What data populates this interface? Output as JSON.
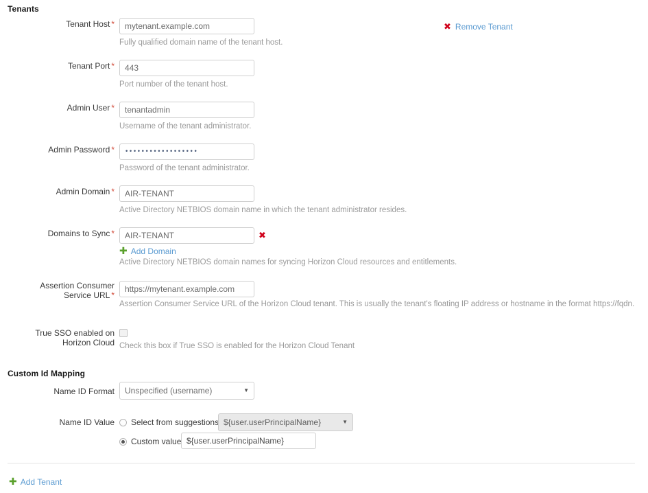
{
  "sections": {
    "tenants_heading": "Tenants",
    "custom_id_heading": "Custom Id Mapping"
  },
  "actions": {
    "remove_tenant": "Remove Tenant",
    "add_domain": "Add Domain",
    "add_tenant": "Add Tenant",
    "remove_domain_icon": "✖",
    "remove_tenant_icon": "✖",
    "add_icon": "✚"
  },
  "fields": {
    "tenant_host": {
      "label": "Tenant Host",
      "required": "*",
      "value": "mytenant.example.com",
      "hint": "Fully qualified domain name of the tenant host."
    },
    "tenant_port": {
      "label": "Tenant Port",
      "required": "*",
      "value": "443",
      "hint": "Port number of the tenant host."
    },
    "admin_user": {
      "label": "Admin User",
      "required": "*",
      "value": "tenantadmin",
      "hint": "Username of the tenant administrator."
    },
    "admin_password": {
      "label": "Admin Password",
      "required": "*",
      "value": "••••••••••••••••••",
      "hint": "Password of the tenant administrator."
    },
    "admin_domain": {
      "label": "Admin Domain",
      "required": "*",
      "value": "AIR-TENANT",
      "hint": "Active Directory NETBIOS domain name in which the tenant administrator resides."
    },
    "domains_to_sync": {
      "label": "Domains to Sync",
      "required": "*",
      "value": "AIR-TENANT",
      "hint": "Active Directory NETBIOS domain names for syncing Horizon Cloud resources and entitlements."
    },
    "assertion_url": {
      "label_line1": "Assertion Consumer",
      "label_line2": "Service URL",
      "required": "*",
      "value": "https://mytenant.example.com",
      "hint": "Assertion Consumer Service URL of the Horizon Cloud tenant. This is usually the tenant's floating IP address or hostname in the format https://fqdn."
    },
    "true_sso": {
      "label_line1": "True SSO enabled on",
      "label_line2": "Horizon Cloud",
      "checked": false,
      "hint": "Check this box if True SSO is enabled for the Horizon Cloud Tenant"
    },
    "name_id_format": {
      "label": "Name ID Format",
      "selected": "Unspecified (username)",
      "caret": "▼"
    },
    "name_id_value": {
      "label": "Name ID Value",
      "suggestion_radio_label": "Select from suggestions",
      "suggestion_selected": false,
      "suggestion_value": "${user.userPrincipalName}",
      "suggestion_caret": "▼",
      "custom_radio_label": "Custom value",
      "custom_selected": true,
      "custom_value": "${user.userPrincipalName}"
    }
  },
  "colors": {
    "required_asterisk": "#d14836",
    "link_blue": "#5b9bd1",
    "remove_red": "#d0021b",
    "add_green": "#5aa02c",
    "hint_gray": "#9a9a9a",
    "border_gray": "#cfcfcf"
  }
}
